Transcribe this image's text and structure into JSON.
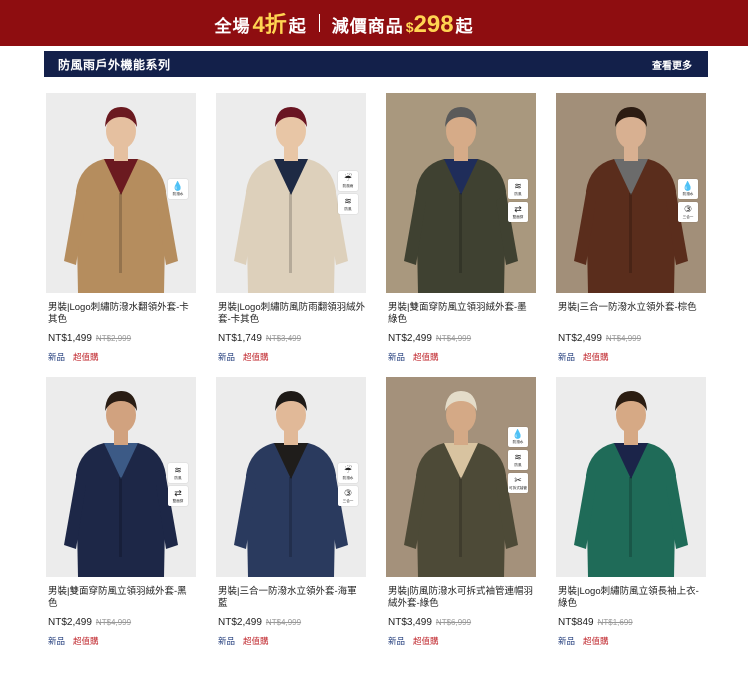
{
  "promo": {
    "part1": "全場",
    "discount": "4折",
    "part2": "起",
    "part3": "減價商品",
    "currency": "$",
    "price": "298",
    "part4": "起"
  },
  "section": {
    "title": "防風雨戶外機能系列",
    "more": "查看更多"
  },
  "products": [
    {
      "name": "男裝|Logo刺繡防潑水翻領外套-卡其色",
      "price": "NT$1,499",
      "old_price": "NT$2,999",
      "tag_new": "新品",
      "tag_deal": "超值購",
      "badges": [
        {
          "icon": "water-drop-icon",
          "label": "防潑水"
        }
      ],
      "colors": {
        "bg": "#ececec",
        "garment": "#b58d5e",
        "accent": "#6b1a20",
        "skin": "#e5c0a0",
        "hair": "#6b1a20"
      }
    },
    {
      "name": "男裝|Logo刺繡防風防雨翻領羽絨外套-卡其色",
      "price": "NT$1,749",
      "old_price": "NT$3,499",
      "tag_new": "新品",
      "tag_deal": "超值購",
      "badges": [
        {
          "icon": "rain-icon",
          "label": "防風雨"
        },
        {
          "icon": "wind-icon",
          "label": "防風"
        }
      ],
      "colors": {
        "bg": "#ececec",
        "garment": "#ddd0bb",
        "accent": "#1e2a44",
        "skin": "#e8c6a6",
        "hair": "#6a1522"
      }
    },
    {
      "name": "男裝|雙面穿防風立領羽絨外套-墨綠色",
      "price": "NT$2,499",
      "old_price": "NT$4,999",
      "tag_new": "新品",
      "tag_deal": "超值購",
      "badges": [
        {
          "icon": "wind-icon",
          "label": "防風"
        },
        {
          "icon": "reversible-icon",
          "label": "雙面穿"
        }
      ],
      "colors": {
        "bg": "#a9987e",
        "garment": "#3f4131",
        "accent": "#1f2d5a",
        "skin": "#d6ab88",
        "hair": "#5a5a5a"
      }
    },
    {
      "name": "男裝|三合一防潑水立領外套-棕色",
      "price": "NT$2,499",
      "old_price": "NT$4,999",
      "tag_new": "新品",
      "tag_deal": "超值購",
      "badges": [
        {
          "icon": "water-drop-icon",
          "label": "防潑水"
        },
        {
          "icon": "three-in-one-icon",
          "label": "三合一"
        }
      ],
      "colors": {
        "bg": "#a28f79",
        "garment": "#5a2d1c",
        "accent": "#6b6b6b",
        "skin": "#d8b091",
        "hair": "#2c1c12"
      }
    },
    {
      "name": "男裝|雙面穿防風立領羽絨外套-黑色",
      "price": "NT$2,499",
      "old_price": "NT$4,999",
      "tag_new": "新品",
      "tag_deal": "超值購",
      "badges": [
        {
          "icon": "wind-icon",
          "label": "防風"
        },
        {
          "icon": "reversible-icon",
          "label": "雙面穿"
        }
      ],
      "colors": {
        "bg": "#ececec",
        "garment": "#1d2747",
        "accent": "#3c5a86",
        "skin": "#d1a27f",
        "hair": "#2a1d14"
      }
    },
    {
      "name": "男裝|三合一防潑水立領外套-海軍藍",
      "price": "NT$2,499",
      "old_price": "NT$4,999",
      "tag_new": "新品",
      "tag_deal": "超值購",
      "badges": [
        {
          "icon": "rain-icon",
          "label": "防潑水"
        },
        {
          "icon": "three-in-one-icon",
          "label": "三合一"
        }
      ],
      "colors": {
        "bg": "#ececec",
        "garment": "#2a3a5e",
        "accent": "#1f1d1b",
        "skin": "#e1b998",
        "hair": "#1e1a17"
      }
    },
    {
      "name": "男裝|防風防潑水可拆式袖管連帽羽絨外套-綠色",
      "price": "NT$3,499",
      "old_price": "NT$6,999",
      "tag_new": "新品",
      "tag_deal": "超值購",
      "badges": [
        {
          "icon": "water-drop-icon",
          "label": "防潑水"
        },
        {
          "icon": "wind-icon",
          "label": "防風"
        },
        {
          "icon": "detachable-icon",
          "label": "可拆式袖管"
        }
      ],
      "colors": {
        "bg": "#a4917b",
        "garment": "#4d4a37",
        "accent": "#d8c3a0",
        "skin": "#d4a986",
        "hair": "#e4dcc9"
      }
    },
    {
      "name": "男裝|Logo刺繡防風立領長袖上衣-綠色",
      "price": "NT$849",
      "old_price": "NT$1,699",
      "tag_new": "新品",
      "tag_deal": "超值購",
      "badges": [],
      "colors": {
        "bg": "#ececec",
        "garment": "#1f6b58",
        "accent": "#1b2449",
        "skin": "#d6a985",
        "hair": "#2b1d12"
      }
    }
  ]
}
